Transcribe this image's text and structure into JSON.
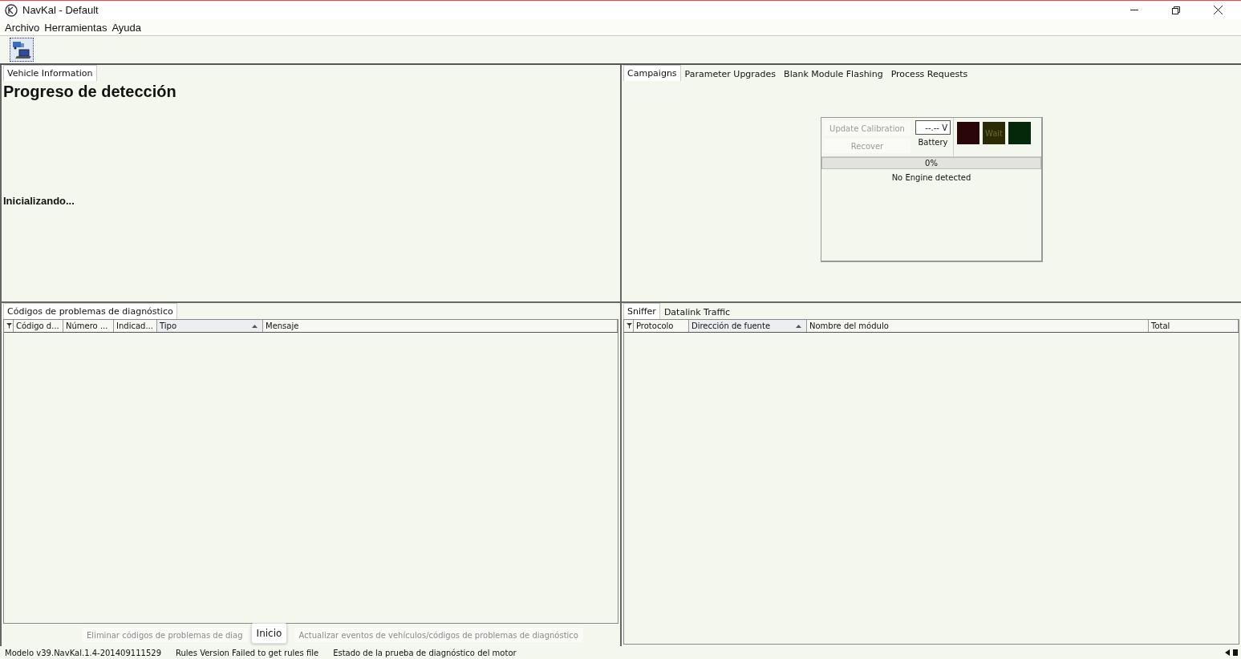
{
  "window": {
    "title": "NavKal - Default"
  },
  "menu": [
    "Archivo",
    "Herramientas",
    "Ayuda"
  ],
  "vehicle_panel": {
    "tabs": [
      {
        "label": "Vehicle Information",
        "selected": true
      }
    ],
    "heading": "Progreso de detección",
    "status": "Inicializando..."
  },
  "campaign_panel": {
    "tabs": [
      {
        "label": "Campaigns",
        "selected": true
      },
      {
        "label": "Parameter Upgrades",
        "selected": false
      },
      {
        "label": "Blank Module Flashing",
        "selected": false
      },
      {
        "label": "Process Requests",
        "selected": false
      }
    ],
    "buttons": [
      {
        "label": "Update Calibration",
        "disabled": true
      },
      {
        "label": "Recover",
        "disabled": true
      }
    ],
    "voltage": "--.-- V",
    "voltage_label": "Battery",
    "lamps": [
      {
        "color": "#2a0608"
      },
      {
        "label": "Wait",
        "color": "#2b2b06"
      },
      {
        "color": "#06280a"
      }
    ],
    "progress": {
      "level": 0,
      "reading": "0%"
    },
    "message": "No Engine detected"
  },
  "dtc_panel": {
    "tabs": [
      {
        "label": "Códigos de problemas de diagnóstico",
        "selected": true
      }
    ],
    "columns": [
      {
        "label": "Código d...",
        "sorted": false
      },
      {
        "label": "Número ...",
        "sorted": false
      },
      {
        "label": "Indicad...",
        "sorted": false
      },
      {
        "label": "Tipo",
        "sorted": true
      },
      {
        "label": "Mensaje",
        "sorted": false
      }
    ],
    "buttons": [
      {
        "label": "Eliminar códigos de problemas de diag"
      },
      {
        "label": "Actualizar eventos de vehículos/códigos de problemas de diagnóstico"
      }
    ],
    "tooltip": "Inicio"
  },
  "sniffer_panel": {
    "tabs": [
      {
        "label": "Sniffer",
        "selected": true
      },
      {
        "label": "Datalink Traffic",
        "selected": false
      }
    ],
    "columns": [
      {
        "label": "Protocolo",
        "sorted": false
      },
      {
        "label": "Dirección de fuente",
        "sorted": true
      },
      {
        "label": "Nombre del módulo",
        "sorted": false
      },
      {
        "label": "Total",
        "sorted": false
      }
    ]
  },
  "status_bar": [
    "Modelo v39.NavKal.1.4-201409111529",
    "Rules Version Failed to get rules file",
    "Estado de la prueba de diagnóstico del motor"
  ]
}
